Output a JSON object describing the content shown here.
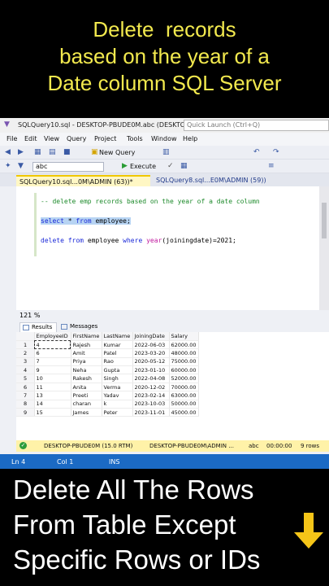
{
  "top_caption": [
    "Delete  records",
    "based on the year of a",
    "Date column SQL Server"
  ],
  "window": {
    "title": "SQLQuery10.sql - DESKTOP-PBUDE0M.abc (DESKTO...",
    "quick_launch": "Quick Launch (Ctrl+Q)",
    "menu": [
      "File",
      "Edit",
      "View",
      "Query",
      "Project",
      "Tools",
      "Window",
      "Help"
    ],
    "toolbar": {
      "new_query": "New Query",
      "database": "abc",
      "execute": "Execute"
    },
    "tabs": {
      "active": "SQLQuery10.sql...0M\\ADMIN (63))*",
      "inactive": "SQLQuery8.sql...E0M\\ADMIN (59))"
    },
    "editor": {
      "comment": "-- delete emp records based on the year of a date column",
      "line2_kw1": "select",
      "line2_rest": " * ",
      "line2_kw2": "from",
      "line2_obj": " employee;",
      "line3_kw1": "delete",
      "line3_kw2": "from",
      "line3_obj": " employee ",
      "line3_kw3": "where",
      "line3_fn": "year",
      "line3_rest": "(joiningdate)=2021;"
    },
    "zoom": "121 %",
    "result_tabs": {
      "results": "Results",
      "messages": "Messages"
    },
    "grid": {
      "columns": [
        "EmployeeID",
        "FirstName",
        "LastName",
        "JoiningDate",
        "Salary"
      ],
      "rows": [
        [
          "1",
          "4",
          "Rajesh",
          "Kumar",
          "2022-06-03",
          "62000.00"
        ],
        [
          "2",
          "6",
          "Amit",
          "Patel",
          "2023-03-20",
          "48000.00"
        ],
        [
          "3",
          "7",
          "Priya",
          "Rao",
          "2020-05-12",
          "75000.00"
        ],
        [
          "4",
          "9",
          "Neha",
          "Gupta",
          "2023-01-10",
          "60000.00"
        ],
        [
          "5",
          "10",
          "Rakesh",
          "Singh",
          "2022-04-08",
          "52000.00"
        ],
        [
          "6",
          "11",
          "Anita",
          "Verma",
          "2020-12-02",
          "70000.00"
        ],
        [
          "7",
          "13",
          "Preeti",
          "Yadav",
          "2023-02-14",
          "63000.00"
        ],
        [
          "8",
          "14",
          "charan",
          "k",
          "2023-10-03",
          "50000.00"
        ],
        [
          "9",
          "15",
          "James",
          "Peter",
          "2023-11-01",
          "45000.00"
        ]
      ]
    },
    "status": {
      "server": "DESKTOP-PBUDE0M (15.0 RTM)",
      "user": "DESKTOP-PBUDE0M\\ADMIN ...",
      "db": "abc",
      "time": "00:00:00",
      "rows": "9 rows"
    },
    "vs_status": {
      "ln": "Ln 4",
      "col": "Col 1",
      "ins": "INS"
    }
  },
  "bottom_caption": [
    "Delete All The Rows",
    "From Table Except",
    "Specific Rows or IDs"
  ],
  "colors": {
    "caption_top": "#f2e94e",
    "arrow": "#f5c518",
    "status_blue": "#1b6ac4"
  }
}
